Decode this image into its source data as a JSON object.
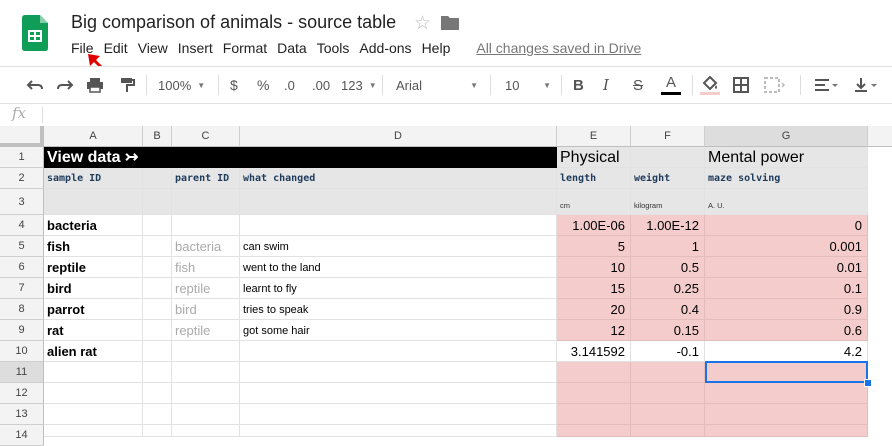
{
  "doc": {
    "title": "Big comparison of animals - source table",
    "saved_status": "All changes saved in Drive"
  },
  "menu": [
    "File",
    "Edit",
    "View",
    "Insert",
    "Format",
    "Data",
    "Tools",
    "Add-ons",
    "Help"
  ],
  "toolbar": {
    "zoom": "100%",
    "currency": "$",
    "percent": "%",
    "decrease_decimals": ".0",
    "increase_decimals": ".00",
    "more_formats": "123",
    "font": "Arial",
    "font_size": "10",
    "bold": "B",
    "italic": "I",
    "strikethrough": "S",
    "text_color": "A",
    "accent_color": "#000000",
    "fill_color": "#f4cccc"
  },
  "formula_bar": {
    "fx": "fx",
    "value": ""
  },
  "columns": [
    "A",
    "B",
    "C",
    "D",
    "E",
    "F",
    "G"
  ],
  "rows": [
    "1",
    "2",
    "3",
    "4",
    "5",
    "6",
    "7",
    "8",
    "9",
    "10",
    "11",
    "12",
    "13",
    "14"
  ],
  "sheet": {
    "row1": {
      "view_data": "View data ↣",
      "physical": "Physical",
      "mental": "Mental power"
    },
    "row2": {
      "sample_id": "sample ID",
      "parent_id": "parent ID",
      "what_changed": "what changed",
      "length": "length",
      "weight": "weight",
      "maze": "maze solving"
    },
    "row3": {
      "cm": "cm",
      "kg": "kilogram",
      "au": "A. U."
    },
    "data": [
      {
        "name": "bacteria",
        "parent": "",
        "change": "",
        "length": "1.00E-06",
        "weight": "1.00E-12",
        "maze": "0"
      },
      {
        "name": "fish",
        "parent": "bacteria",
        "change": "can swim",
        "length": "5",
        "weight": "1",
        "maze": "0.001"
      },
      {
        "name": "reptile",
        "parent": "fish",
        "change": "went to the land",
        "length": "10",
        "weight": "0.5",
        "maze": "0.01"
      },
      {
        "name": "bird",
        "parent": "reptile",
        "change": "learnt to fly",
        "length": "15",
        "weight": "0.25",
        "maze": "0.1"
      },
      {
        "name": "parrot",
        "parent": "bird",
        "change": "tries to speak",
        "length": "20",
        "weight": "0.4",
        "maze": "0.9"
      },
      {
        "name": "rat",
        "parent": "reptile",
        "change": "got some hair",
        "length": "12",
        "weight": "0.15",
        "maze": "0.6"
      },
      {
        "name": "alien rat",
        "parent": "",
        "change": "",
        "length": "3.141592",
        "weight": "-0.1",
        "maze": "4.2"
      }
    ]
  },
  "selected_cell": "G11",
  "colors": {
    "pink": "#f4cccc",
    "header_black": "#000000",
    "selection": "#1a73e8",
    "arrow": "#e00000"
  }
}
